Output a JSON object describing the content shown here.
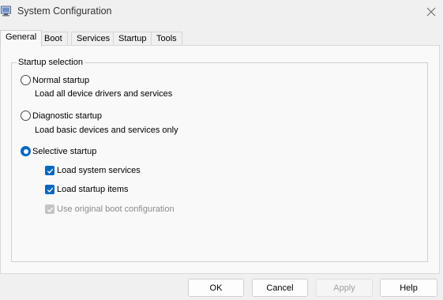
{
  "window": {
    "title": "System Configuration",
    "icon": "msconfig-icon"
  },
  "tabs": [
    {
      "label": "General",
      "active": true
    },
    {
      "label": "Boot",
      "active": false
    },
    {
      "label": "Services",
      "active": false
    },
    {
      "label": "Startup",
      "active": false
    },
    {
      "label": "Tools",
      "active": false
    }
  ],
  "startup_selection": {
    "group_label": "Startup selection",
    "selected": "selective",
    "normal": {
      "label": "Normal startup",
      "description": "Load all device drivers and services"
    },
    "diagnostic": {
      "label": "Diagnostic startup",
      "description": "Load basic devices and services only"
    },
    "selective": {
      "label": "Selective startup",
      "options": {
        "system_services": {
          "label": "Load system services",
          "checked": true,
          "enabled": true
        },
        "startup_items": {
          "label": "Load startup items",
          "checked": true,
          "enabled": true
        },
        "original_boot": {
          "label": "Use original boot configuration",
          "checked": true,
          "enabled": false
        }
      }
    }
  },
  "buttons": {
    "ok": "OK",
    "cancel": "Cancel",
    "apply": "Apply",
    "help": "Help"
  },
  "colors": {
    "accent": "#0067c0",
    "window_bg": "#f0f0f0",
    "panel_bg": "#f9f9f9"
  }
}
